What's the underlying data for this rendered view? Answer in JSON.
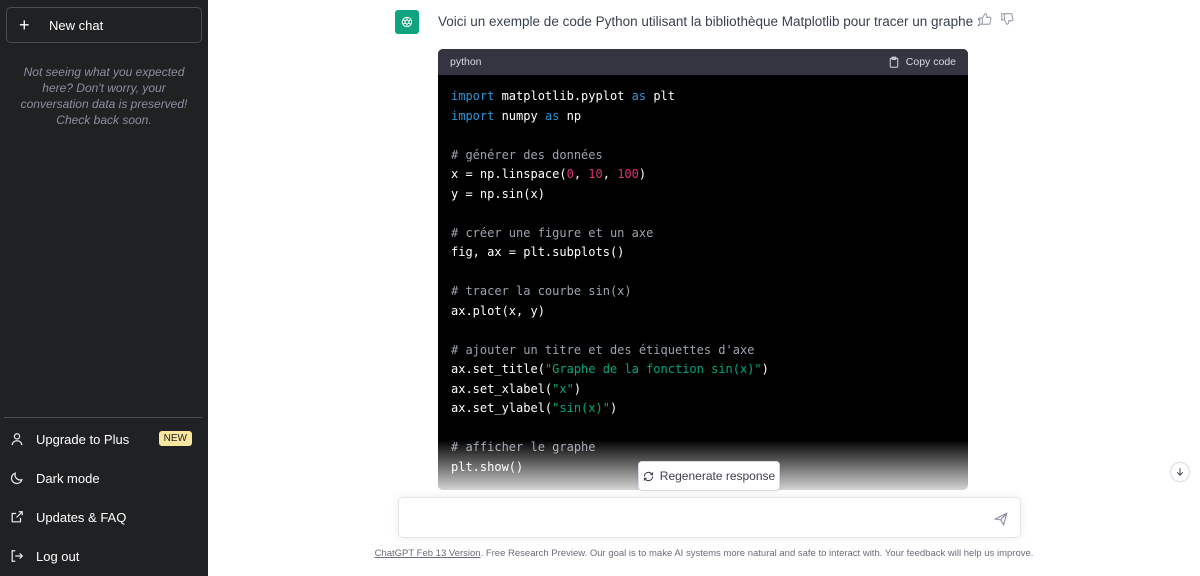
{
  "sidebar": {
    "new_chat_label": "New chat",
    "notice": "Not seeing what you expected here? Don't worry, your conversation data is preserved! Check back soon.",
    "items": [
      {
        "label": "Upgrade to Plus",
        "icon": "user-icon",
        "badge": "NEW"
      },
      {
        "label": "Dark mode",
        "icon": "moon-icon"
      },
      {
        "label": "Updates & FAQ",
        "icon": "external-link-icon"
      },
      {
        "label": "Log out",
        "icon": "logout-icon"
      }
    ]
  },
  "message": {
    "intro": "Voici un exemple de code Python utilisant la bibliothèque Matplotlib pour tracer un graphe :",
    "code_language": "python",
    "copy_label": "Copy code",
    "code_lines": [
      "import matplotlib.pyplot as plt",
      "import numpy as np",
      "",
      "# générer des données",
      "x = np.linspace(0, 10, 100)",
      "y = np.sin(x)",
      "",
      "# créer une figure et un axe",
      "fig, ax = plt.subplots()",
      "",
      "# tracer la courbe sin(x)",
      "ax.plot(x, y)",
      "",
      "# ajouter un titre et des étiquettes d'axe",
      "ax.set_title(\"Graphe de la fonction sin(x)\")",
      "ax.set_xlabel(\"x\")",
      "ax.set_ylabel(\"sin(x)\")",
      "",
      "# afficher le graphe",
      "plt.show()"
    ]
  },
  "regenerate_label": "Regenerate response",
  "input": {
    "placeholder": ""
  },
  "footer": {
    "link_text": "ChatGPT Feb 13 Version",
    "text": ". Free Research Preview. Our goal is to make AI systems more natural and safe to interact with. Your feedback will help us improve."
  },
  "colors": {
    "sidebar_bg": "#202123",
    "accent": "#10a37f",
    "code_bg": "#000000"
  }
}
